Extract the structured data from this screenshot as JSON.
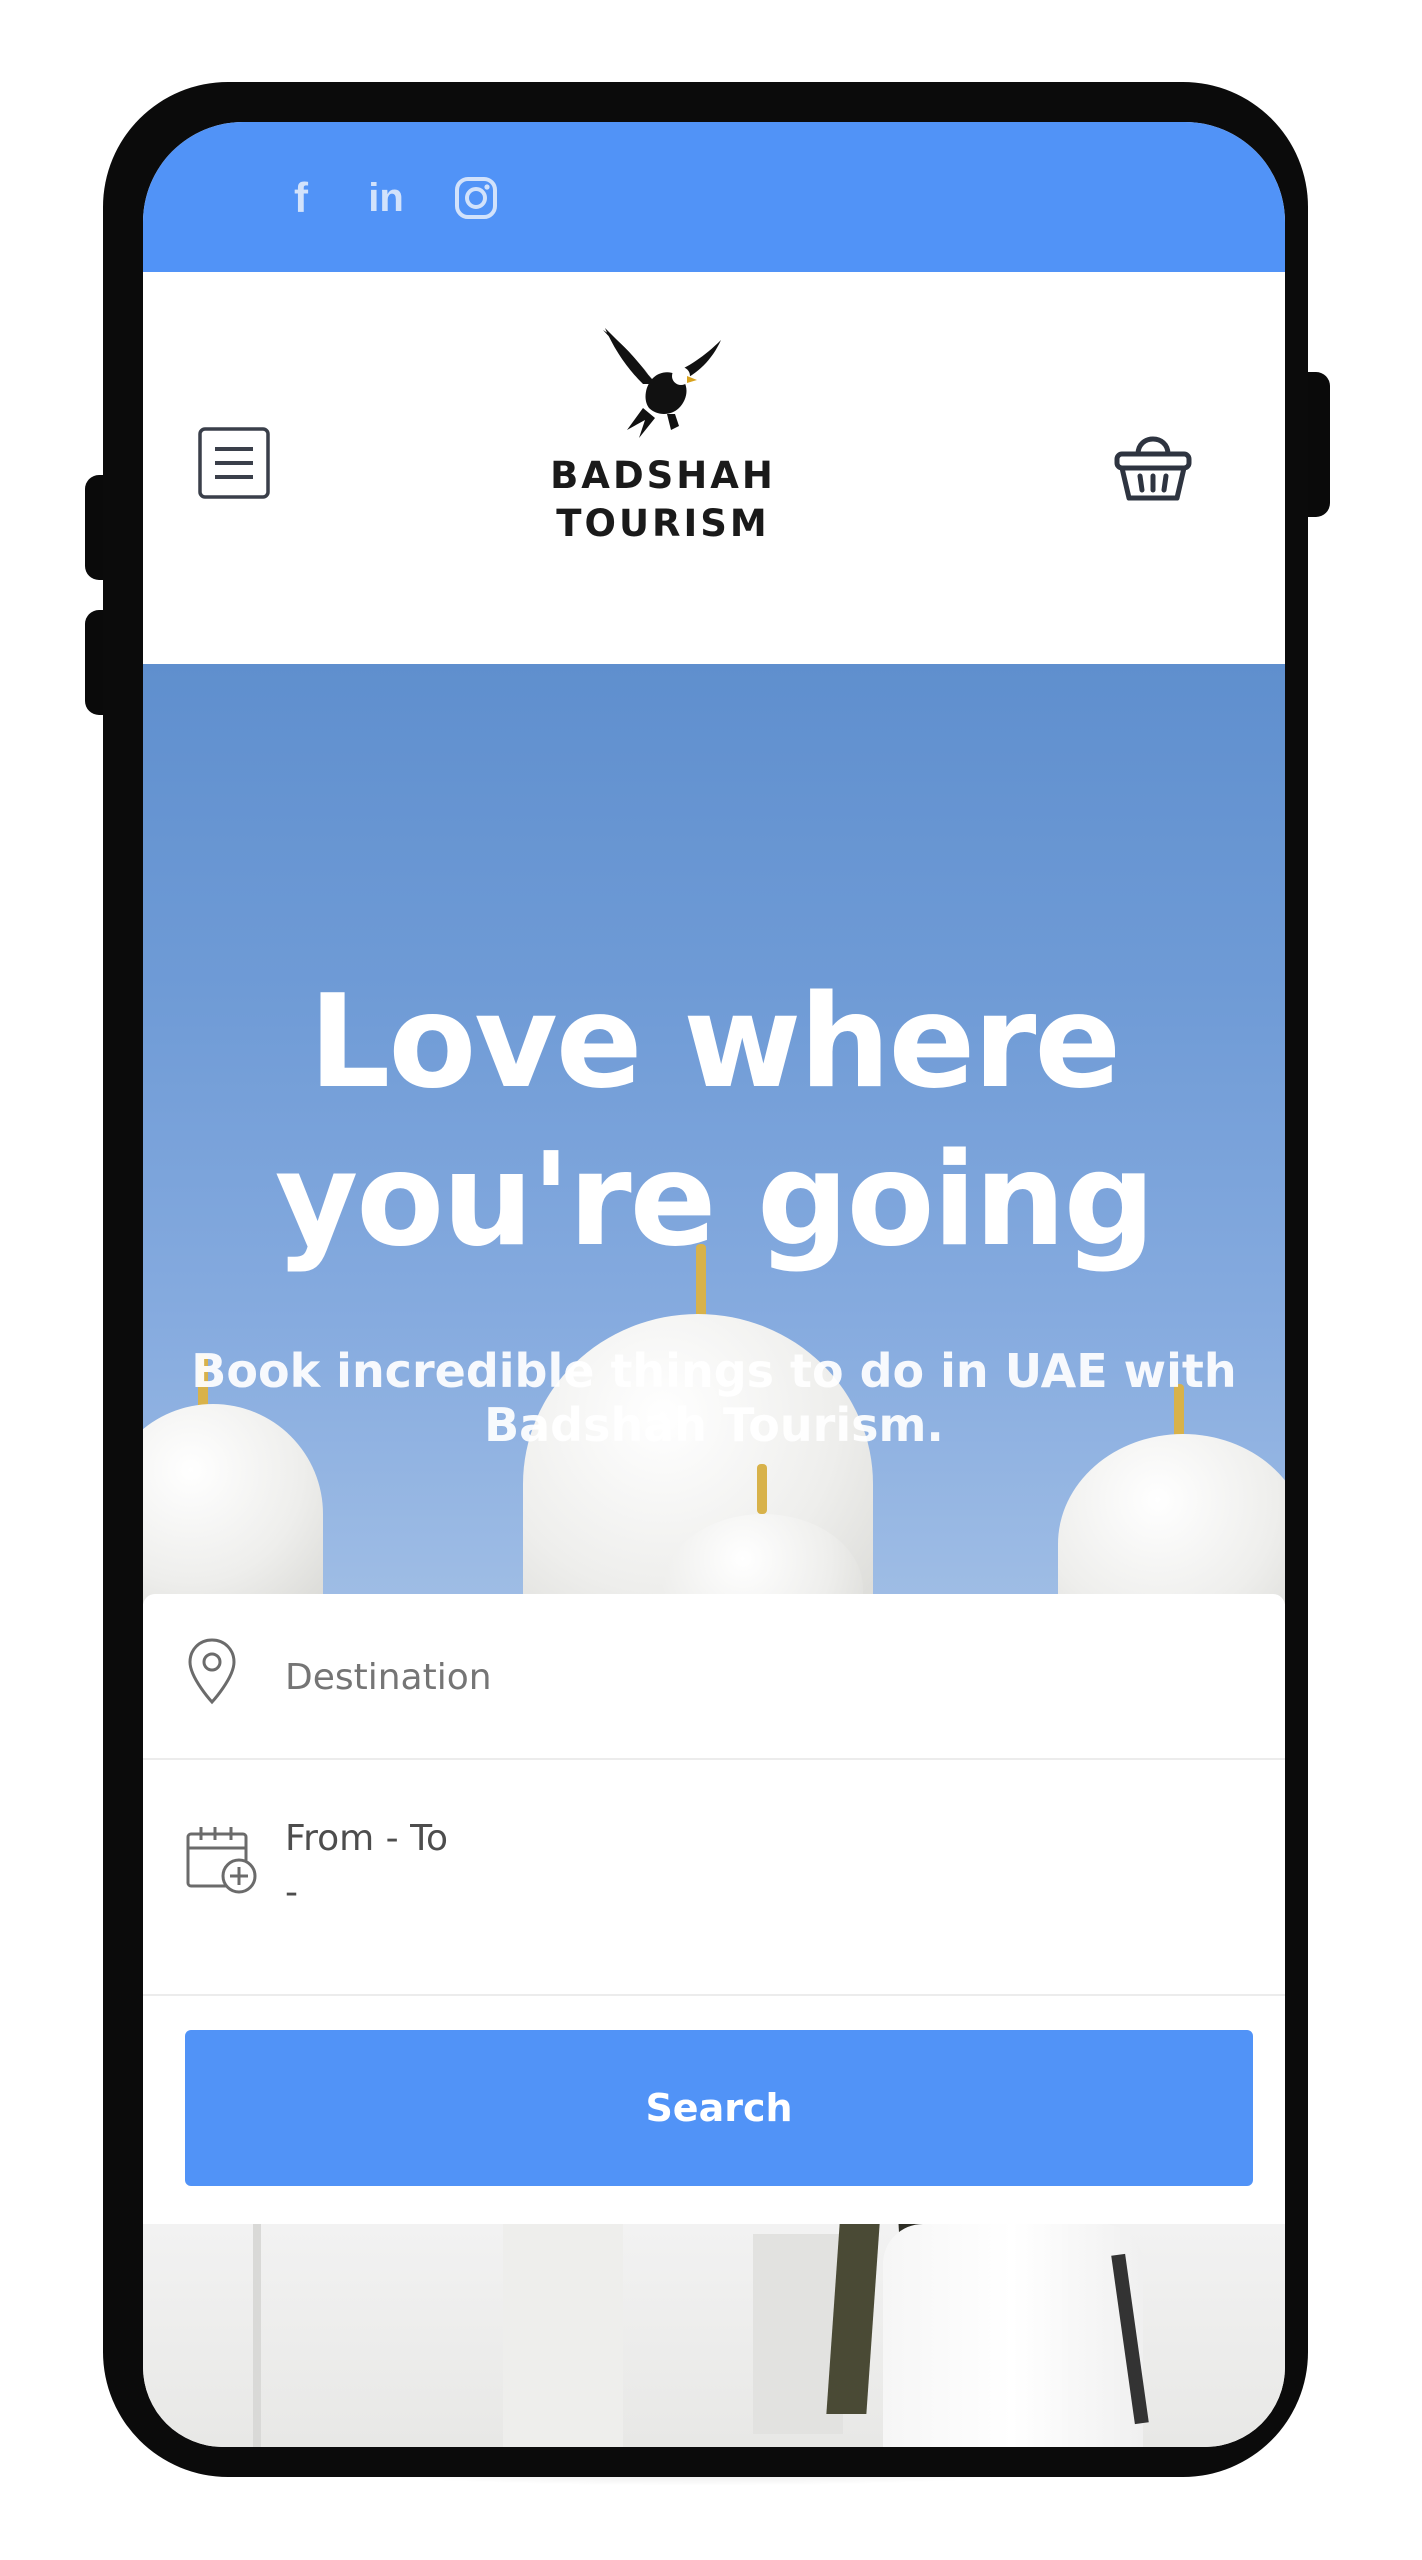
{
  "social": {
    "facebook_label": "f",
    "linkedin_label": "in",
    "instagram_icon": "instagram-icon"
  },
  "header": {
    "menu_icon": "hamburger-menu-icon",
    "cart_icon": "basket-icon",
    "logo_line1": "BADSHAH",
    "logo_line2": "TOURISM"
  },
  "hero": {
    "title_line1": "Love where",
    "title_line2": "you're going",
    "subtitle": "Book incredible things to do in UAE with Badshah Tourism."
  },
  "search_form": {
    "destination_placeholder": "Destination",
    "dates_label": "From - To",
    "dates_value": "-",
    "search_button": "Search"
  },
  "colors": {
    "brand_blue": "#5193f7",
    "hero_sky": "#6f9bd6",
    "phone_frame": "#0b0b0b"
  }
}
